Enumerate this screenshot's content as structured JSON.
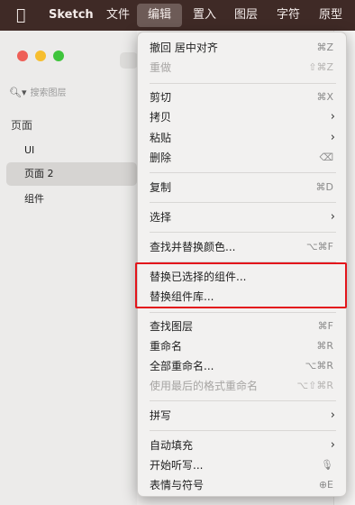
{
  "menubar": {
    "apple_icon": "",
    "app_name": "Sketch",
    "items": [
      "文件",
      "编辑",
      "置入",
      "图层",
      "字符",
      "原型"
    ],
    "active_item": "编辑"
  },
  "sidebar": {
    "search_placeholder": "搜索图层",
    "section_title": "页面",
    "pages": [
      "UI",
      "页面 2",
      "组件"
    ],
    "selected_page": "页面 2"
  },
  "edit_menu": {
    "items": [
      {
        "label": "撤回 居中对齐",
        "shortcut": "⌘Z",
        "enabled": true
      },
      {
        "label": "重做",
        "shortcut": "⇧⌘Z",
        "enabled": false
      },
      {
        "label": "剪切",
        "shortcut": "⌘X",
        "enabled": true
      },
      {
        "label": "拷贝",
        "submenu": true,
        "enabled": true
      },
      {
        "label": "粘贴",
        "submenu": true,
        "enabled": true
      },
      {
        "label": "删除",
        "shortcut": "⌫",
        "enabled": true
      },
      {
        "label": "复制",
        "shortcut": "⌘D",
        "enabled": true
      },
      {
        "label": "选择",
        "submenu": true,
        "enabled": true
      },
      {
        "label": "查找并替换颜色...",
        "shortcut": "⌥⌘F",
        "enabled": true
      },
      {
        "label": "替换已选择的组件...",
        "enabled": true
      },
      {
        "label": "替换组件库...",
        "enabled": true
      },
      {
        "label": "查找图层",
        "shortcut": "⌘F",
        "enabled": true
      },
      {
        "label": "重命名",
        "shortcut": "⌘R",
        "enabled": true
      },
      {
        "label": "全部重命名...",
        "shortcut": "⌥⌘R",
        "enabled": true
      },
      {
        "label": "使用最后的格式重命名",
        "shortcut": "⌥⇧⌘R",
        "enabled": false
      },
      {
        "label": "拼写",
        "submenu": true,
        "enabled": true
      },
      {
        "label": "自动填充",
        "submenu": true,
        "enabled": true
      },
      {
        "label": "开始听写...",
        "shortcut": "🎙",
        "enabled": true
      },
      {
        "label": "表情与符号",
        "shortcut": "⊕E",
        "enabled": true
      }
    ]
  },
  "highlight_color": "#e3141b"
}
